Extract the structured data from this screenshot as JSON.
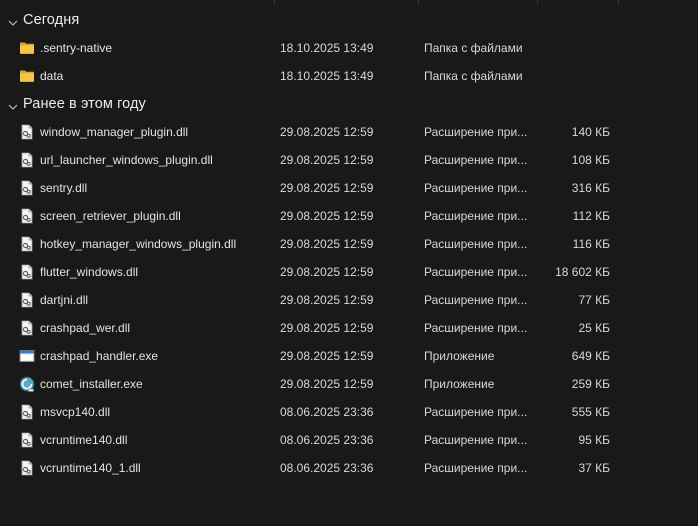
{
  "groups": [
    {
      "title": "Сегодня",
      "items": [
        {
          "name": ".sentry-native",
          "date": "18.10.2025 13:49",
          "type": "Папка с файлами",
          "size": "",
          "icon": "folder-icon"
        },
        {
          "name": "data",
          "date": "18.10.2025 13:49",
          "type": "Папка с файлами",
          "size": "",
          "icon": "folder-icon"
        }
      ]
    },
    {
      "title": "Ранее в этом году",
      "items": [
        {
          "name": "window_manager_plugin.dll",
          "date": "29.08.2025 12:59",
          "type": "Расширение при...",
          "size": "140 КБ",
          "icon": "dll-file-icon"
        },
        {
          "name": "url_launcher_windows_plugin.dll",
          "date": "29.08.2025 12:59",
          "type": "Расширение при...",
          "size": "108 КБ",
          "icon": "dll-file-icon"
        },
        {
          "name": "sentry.dll",
          "date": "29.08.2025 12:59",
          "type": "Расширение при...",
          "size": "316 КБ",
          "icon": "dll-file-icon"
        },
        {
          "name": "screen_retriever_plugin.dll",
          "date": "29.08.2025 12:59",
          "type": "Расширение при...",
          "size": "112 КБ",
          "icon": "dll-file-icon"
        },
        {
          "name": "hotkey_manager_windows_plugin.dll",
          "date": "29.08.2025 12:59",
          "type": "Расширение при...",
          "size": "116 КБ",
          "icon": "dll-file-icon"
        },
        {
          "name": "flutter_windows.dll",
          "date": "29.08.2025 12:59",
          "type": "Расширение при...",
          "size": "18 602 КБ",
          "icon": "dll-file-icon"
        },
        {
          "name": "dartjni.dll",
          "date": "29.08.2025 12:59",
          "type": "Расширение при...",
          "size": "77 КБ",
          "icon": "dll-file-icon"
        },
        {
          "name": "crashpad_wer.dll",
          "date": "29.08.2025 12:59",
          "type": "Расширение при...",
          "size": "25 КБ",
          "icon": "dll-file-icon"
        },
        {
          "name": "crashpad_handler.exe",
          "date": "29.08.2025 12:59",
          "type": "Приложение",
          "size": "649 КБ",
          "icon": "exe-app-icon"
        },
        {
          "name": "comet_installer.exe",
          "date": "29.08.2025 12:59",
          "type": "Приложение",
          "size": "259 КБ",
          "icon": "installer-app-icon"
        },
        {
          "name": "msvcp140.dll",
          "date": "08.06.2025 23:36",
          "type": "Расширение при...",
          "size": "555 КБ",
          "icon": "dll-file-icon"
        },
        {
          "name": "vcruntime140.dll",
          "date": "08.06.2025 23:36",
          "type": "Расширение при...",
          "size": "95 КБ",
          "icon": "dll-file-icon"
        },
        {
          "name": "vcruntime140_1.dll",
          "date": "08.06.2025 23:36",
          "type": "Расширение при...",
          "size": "37 КБ",
          "icon": "dll-file-icon"
        }
      ]
    }
  ],
  "colors": {
    "background": "#191919",
    "folder": "#f3c548",
    "text": "#e3e3e3"
  }
}
